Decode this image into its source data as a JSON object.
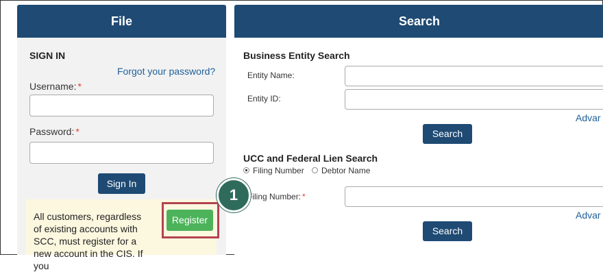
{
  "file_panel": {
    "title": "File",
    "sign_in_heading": "SIGN IN",
    "forgot_link": "Forgot your password?",
    "username_label": "Username:",
    "password_label": "Password:",
    "required_mark": "*",
    "sign_in_button": "Sign In",
    "notice_text": "All customers, regardless of existing accounts with SCC, must register for a new account in the CIS. If you",
    "register_button": "Register"
  },
  "callout": {
    "number": "1"
  },
  "search_panel": {
    "title": "Search",
    "business_heading": "Business Entity Search",
    "entity_name_label": "Entity Name:",
    "entity_id_label": "Entity ID:",
    "advanced_link": "Advar",
    "search_button": "Search",
    "ucc_heading": "UCC and Federal Lien Search",
    "radio_filing": "Filing Number",
    "radio_debtor": "Debtor Name",
    "filing_label": "Filing Number:",
    "advanced_link2": "Advar",
    "search_button2": "Search"
  },
  "colors": {
    "header": "#1e4a73",
    "register": "#4cb35a",
    "outline": "#b3434f",
    "badge": "#2f6b5b"
  }
}
